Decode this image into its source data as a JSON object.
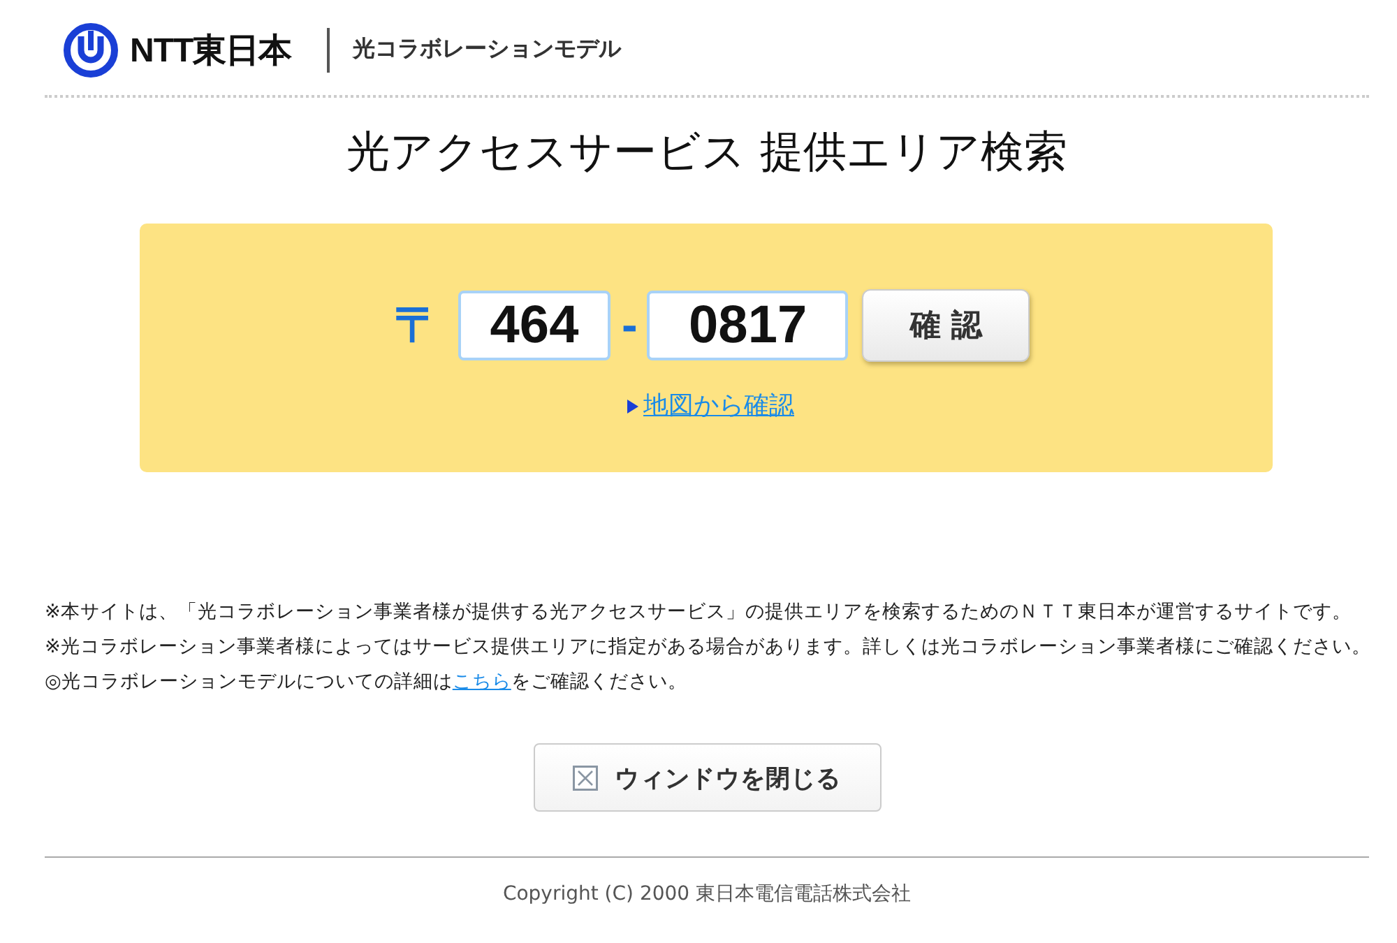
{
  "header": {
    "logo_text": "NTT東日本",
    "subtitle": "光コラボレーションモデル"
  },
  "title": "光アクセスサービス 提供エリア検索",
  "search": {
    "postal_mark": "〒",
    "zip_first": "464",
    "separator": "-",
    "zip_second": "0817",
    "confirm_button": "確 認",
    "map_link": "地図から確認"
  },
  "notes": [
    {
      "text": "※本サイトは、「光コラボレーション事業者様が提供する光アクセスサービス」の提供エリアを検索するためのＮＴＴ東日本が運営するサイトです。"
    },
    {
      "text": "※光コラボレーション事業者様によってはサービス提供エリアに指定がある場合があります。詳しくは光コラボレーション事業者様にご確認ください。"
    },
    {
      "text": "◎光コラボレーションモデルについての詳細は",
      "link": "こちら",
      "after": "をご確認ください。"
    }
  ],
  "close_button": "ウィンドウを閉じる",
  "footer": {
    "copyright": "Copyright (C) 2000 東日本電信電話株式会社"
  }
}
